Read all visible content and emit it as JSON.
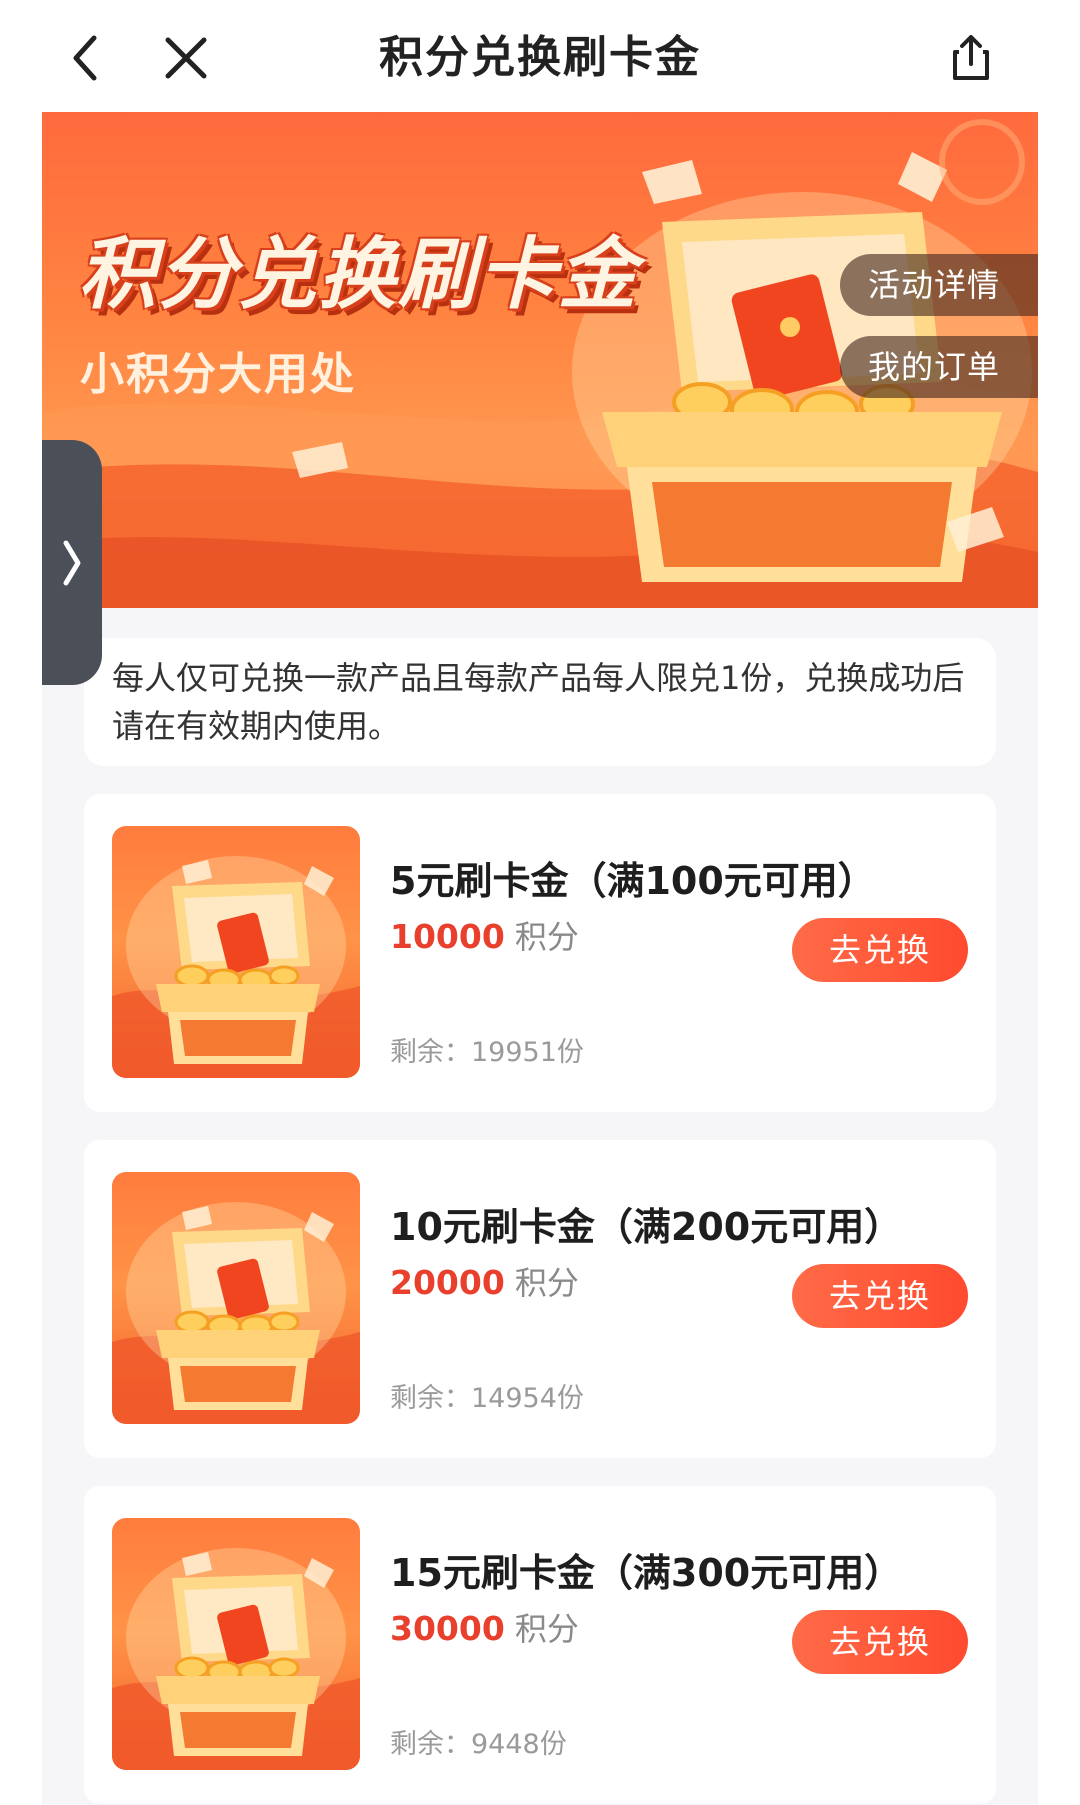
{
  "navbar": {
    "title": "积分兑换刷卡金",
    "back_icon": "chevron-left-icon",
    "close_icon": "close-icon",
    "share_icon": "share-icon"
  },
  "banner": {
    "title": "积分兑换刷卡金",
    "subtitle": "小积分大用处",
    "details_button": "活动详情",
    "orders_button": "我的订单"
  },
  "side_tab": {
    "icon": "chevron-right-icon"
  },
  "notice": {
    "text": "每人仅可兑换一款产品且每款产品每人限兑1份，兑换成功后请在有效期内使用。"
  },
  "products": [
    {
      "title": "5元刷卡金（满100元可用）",
      "points": "10000",
      "points_unit": "积分",
      "stock": "剩余：19951份",
      "button": "去兑换"
    },
    {
      "title": "10元刷卡金（满200元可用）",
      "points": "20000",
      "points_unit": "积分",
      "stock": "剩余：14954份",
      "button": "去兑换"
    },
    {
      "title": "15元刷卡金（满300元可用）",
      "points": "30000",
      "points_unit": "积分",
      "stock": "剩余：9448份",
      "button": "去兑换"
    }
  ],
  "colors": {
    "accent": "#ff4a2f",
    "points": "#e8402c",
    "banner_orange": "#ff8240"
  }
}
